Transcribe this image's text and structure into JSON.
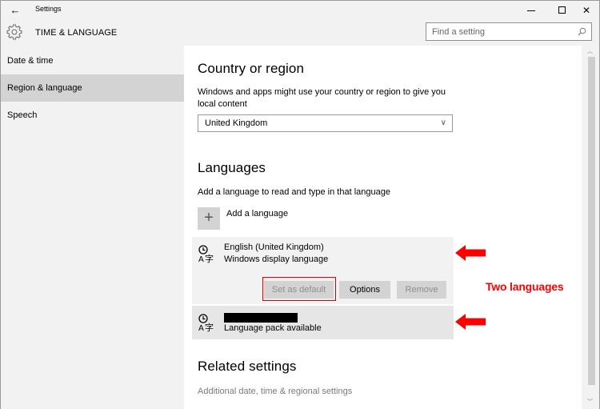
{
  "titlebar": {
    "back_icon": "back-arrow-icon",
    "back_glyph": "←",
    "app_title": "Settings",
    "minimize_glyph": "—",
    "close_glyph": "✕"
  },
  "header": {
    "icon": "gear-icon",
    "title": "TIME & LANGUAGE",
    "search_placeholder": "Find a setting",
    "search_value": ""
  },
  "sidebar": {
    "items": [
      {
        "label": "Date & time",
        "selected": false
      },
      {
        "label": "Region & language",
        "selected": true
      },
      {
        "label": "Speech",
        "selected": false
      }
    ]
  },
  "country": {
    "heading": "Country or region",
    "description_line1": "Windows and apps might use your country or region to give you",
    "description_line2": "local content",
    "selected": "United Kingdom",
    "chevron": "∨"
  },
  "languages": {
    "heading": "Languages",
    "description": "Add a language to read and type in that language",
    "add_glyph": "+",
    "add_label": "Add a language",
    "items": [
      {
        "name": "English (United Kingdom)",
        "subtitle": "Windows display language",
        "buttons": {
          "set_default": "Set as default",
          "options": "Options",
          "remove": "Remove"
        }
      },
      {
        "name": "[redacted]",
        "subtitle": "Language pack available"
      }
    ]
  },
  "related": {
    "heading": "Related settings",
    "link": "Additional date, time & regional settings"
  },
  "scrollbar": {
    "up_glyph": "︿",
    "down_glyph": "﹀"
  },
  "annotation": {
    "text": "Two languages",
    "color": "#ff0000"
  },
  "colors": {
    "chrome_bg": "#f2f2f2",
    "selected_bg": "#d3d3d3",
    "button_bg": "#d3d3d3",
    "annotation_red": "#ff0000"
  }
}
